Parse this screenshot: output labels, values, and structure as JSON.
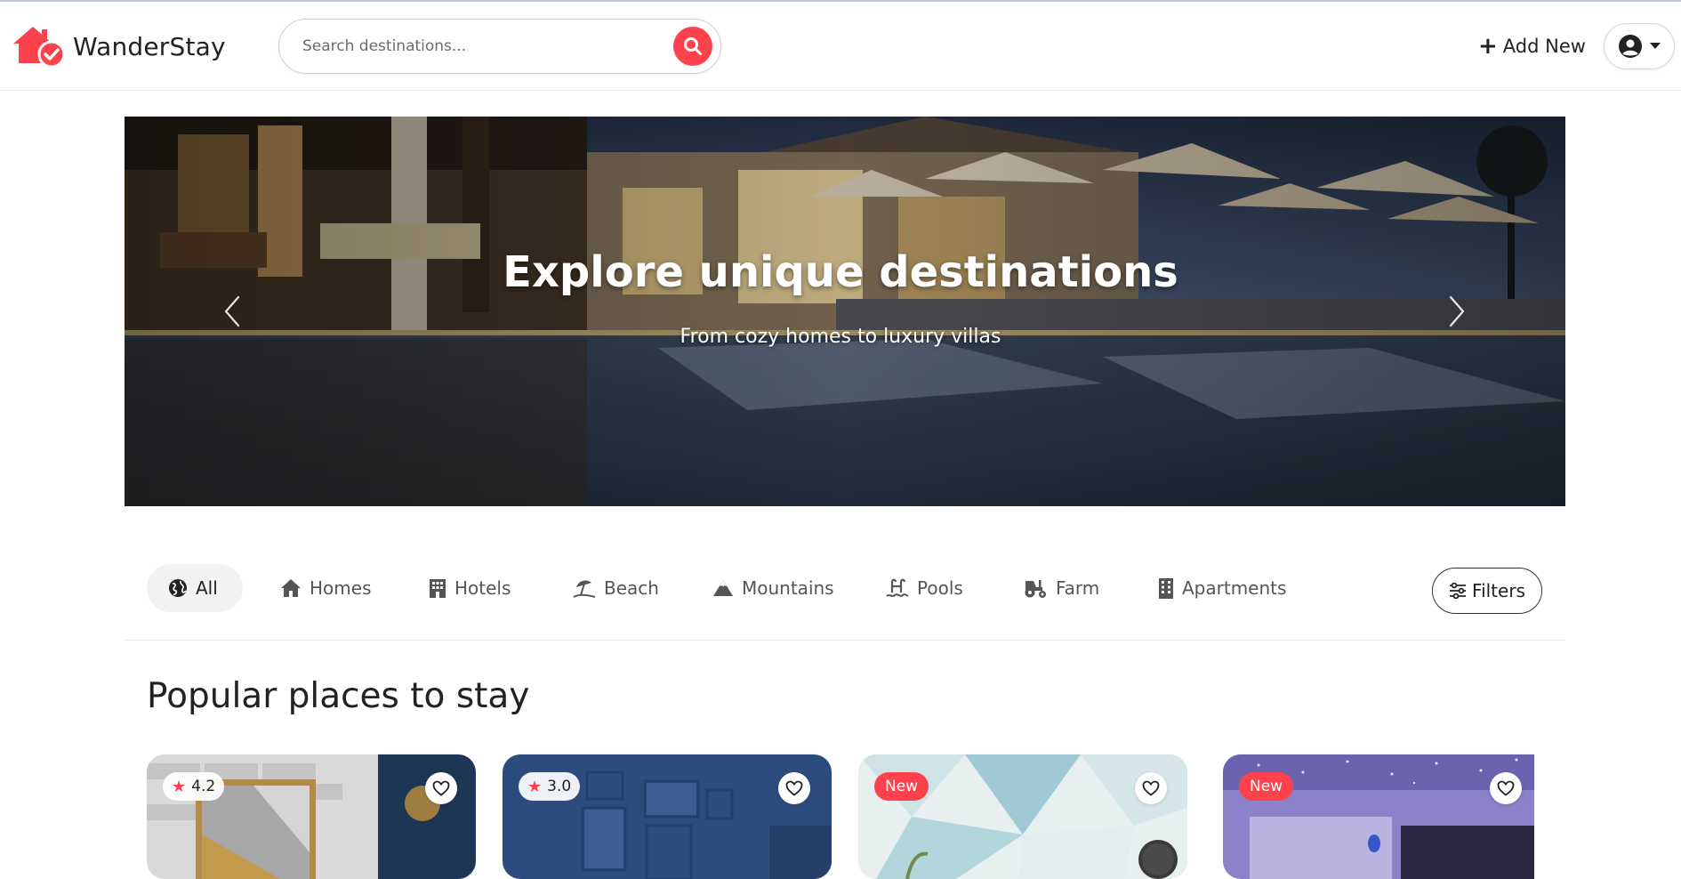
{
  "brand": {
    "name": "WanderStay",
    "accent": "#fe424d"
  },
  "search": {
    "placeholder": "Search destinations..."
  },
  "nav": {
    "add_new_label": "Add New",
    "add_new_icon": "plus-icon",
    "user_icon": "user-circle-icon"
  },
  "hero": {
    "title": "Explore unique destinations",
    "subtitle": "From cozy homes to luxury villas"
  },
  "categories": [
    {
      "label": "All",
      "icon": "globe-icon",
      "active": true
    },
    {
      "label": "Homes",
      "icon": "house-icon"
    },
    {
      "label": "Hotels",
      "icon": "building-icon"
    },
    {
      "label": "Beach",
      "icon": "umbrella-beach-icon"
    },
    {
      "label": "Mountains",
      "icon": "mountain-icon"
    },
    {
      "label": "Pools",
      "icon": "pool-icon"
    },
    {
      "label": "Farm",
      "icon": "tractor-icon"
    },
    {
      "label": "Apartments",
      "icon": "apartment-icon"
    }
  ],
  "filters": {
    "label": "Filters"
  },
  "section": {
    "title": "Popular places to stay"
  },
  "listings": [
    {
      "badge_type": "rating",
      "rating": "4.2"
    },
    {
      "badge_type": "rating",
      "rating": "3.0"
    },
    {
      "badge_type": "new",
      "badge_label": "New"
    },
    {
      "badge_type": "new",
      "badge_label": "New"
    }
  ]
}
